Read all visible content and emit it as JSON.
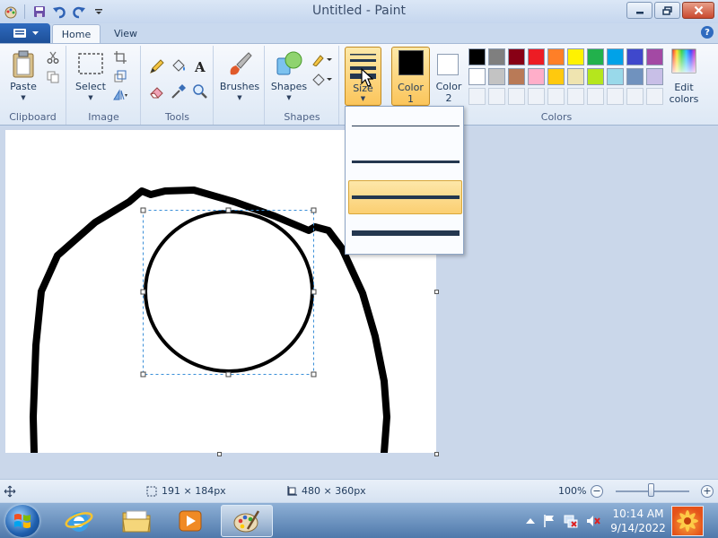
{
  "window": {
    "title": "Untitled - Paint"
  },
  "tabs": {
    "home": "Home",
    "view": "View"
  },
  "ribbon": {
    "clipboard": {
      "paste": "Paste",
      "group": "Clipboard"
    },
    "image": {
      "select": "Select",
      "group": "Image"
    },
    "tools": {
      "group": "Tools"
    },
    "brushes": {
      "label": "Brushes"
    },
    "shapes": {
      "label": "Shapes",
      "group": "Shapes"
    },
    "size": {
      "label": "Size"
    },
    "color1": {
      "label": "Color",
      "num": "1"
    },
    "color2": {
      "label": "Color",
      "num": "2"
    },
    "colors": {
      "group": "Colors",
      "edit_line1": "Edit",
      "edit_line2": "colors"
    }
  },
  "palette": {
    "row1": [
      "#000000",
      "#7f7f7f",
      "#880015",
      "#ed1c24",
      "#ff7f27",
      "#fff200",
      "#22b14c",
      "#00a2e8",
      "#3f48cc",
      "#a349a4"
    ],
    "row2": [
      "#ffffff",
      "#c3c3c3",
      "#b97a57",
      "#ffaec9",
      "#ffc90e",
      "#efe4b0",
      "#b5e61d",
      "#99d9ea",
      "#7092be",
      "#c8bfe7"
    ]
  },
  "status": {
    "selection_size": "191 × 184px",
    "canvas_size": "480 × 360px",
    "zoom": "100%"
  },
  "taskbar": {
    "time": "10:14 AM",
    "date": "9/14/2022"
  }
}
